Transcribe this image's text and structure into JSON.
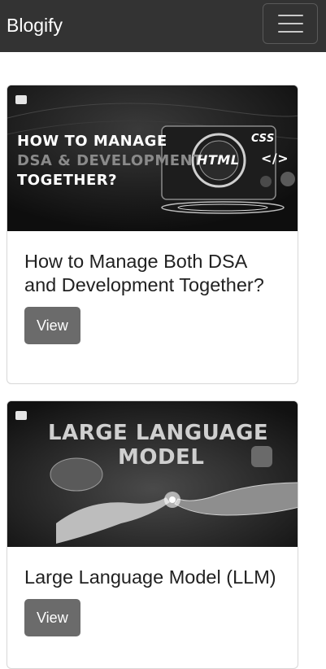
{
  "navbar": {
    "brand": "Blogify",
    "toggler_icon": "hamburger-menu-icon"
  },
  "posts": [
    {
      "image_text": {
        "line1": "HOW TO MANAGE",
        "line2": "DSA & DEVELOPMENT",
        "line3": "TOGETHER?",
        "badge_html": "HTML",
        "badge_css": "CSS",
        "badge_tag": "</>"
      },
      "title": "How to Manage Both DSA and Development Together?",
      "button_label": "View"
    },
    {
      "image_text": {
        "line1": "LARGE LANGUAGE",
        "line2": "MODEL"
      },
      "title": "Large Language Model (LLM)",
      "button_label": "View"
    }
  ]
}
